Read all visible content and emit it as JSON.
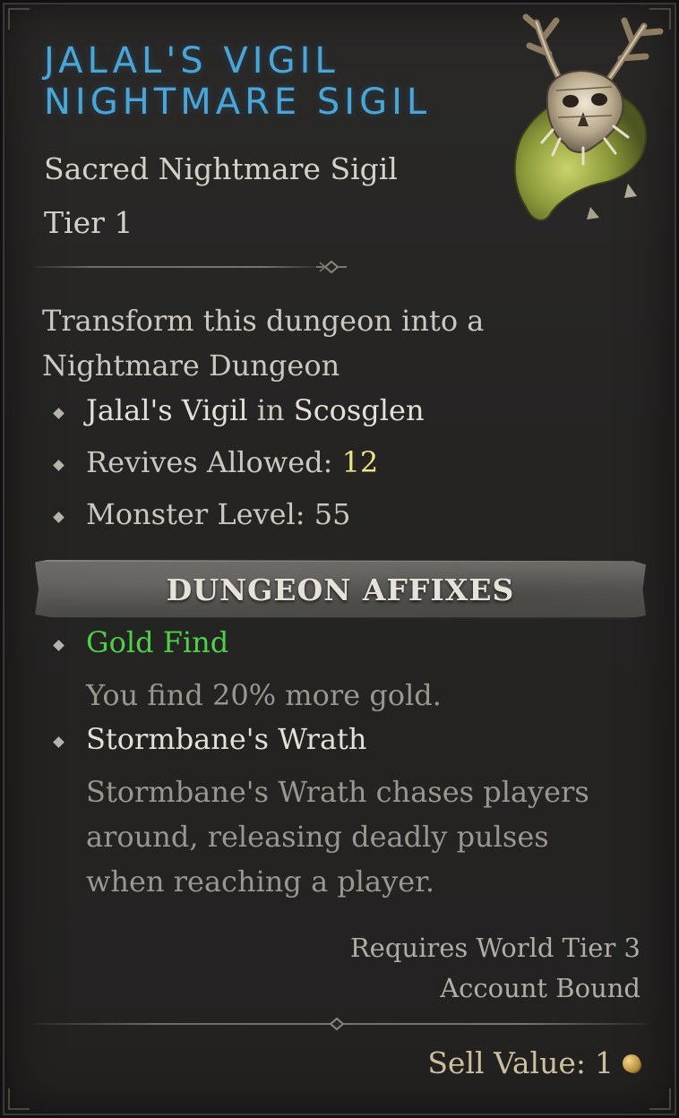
{
  "item": {
    "name_line1": "JALAL'S VIGIL",
    "name_line2": "NIGHTMARE SIGIL",
    "type": "Sacred Nightmare Sigil",
    "tier": "Tier 1",
    "description": "Transform this dungeon into a Nightmare Dungeon"
  },
  "properties": {
    "location_dungeon": "Jalal's Vigil",
    "location_in": "in",
    "location_region": "Scosglen",
    "revives_label": "Revives Allowed:",
    "revives_value": "12",
    "monster_level_label": "Monster Level:",
    "monster_level_value": "55"
  },
  "affixes": {
    "header": "DUNGEON AFFIXES",
    "items": [
      {
        "name": "Gold Find",
        "description": "You find 20% more gold."
      },
      {
        "name": "Stormbane's Wrath",
        "description": "Stormbane's Wrath chases players around, releasing deadly pulses when reaching a player."
      }
    ]
  },
  "requirements": {
    "world_tier": "Requires World Tier 3",
    "binding": "Account Bound"
  },
  "sell": {
    "label": "Sell Value:",
    "value": "1",
    "currency_icon": "gold-coin-icon"
  },
  "colors": {
    "title": "#4aa6d6",
    "affix_name_highlight": "#4fd048",
    "revives_value": "#ebe486",
    "background": "#252423"
  },
  "icons": {
    "emblem": "stag-skull-sigil-icon",
    "bullet": "diamond-bullet-icon"
  }
}
